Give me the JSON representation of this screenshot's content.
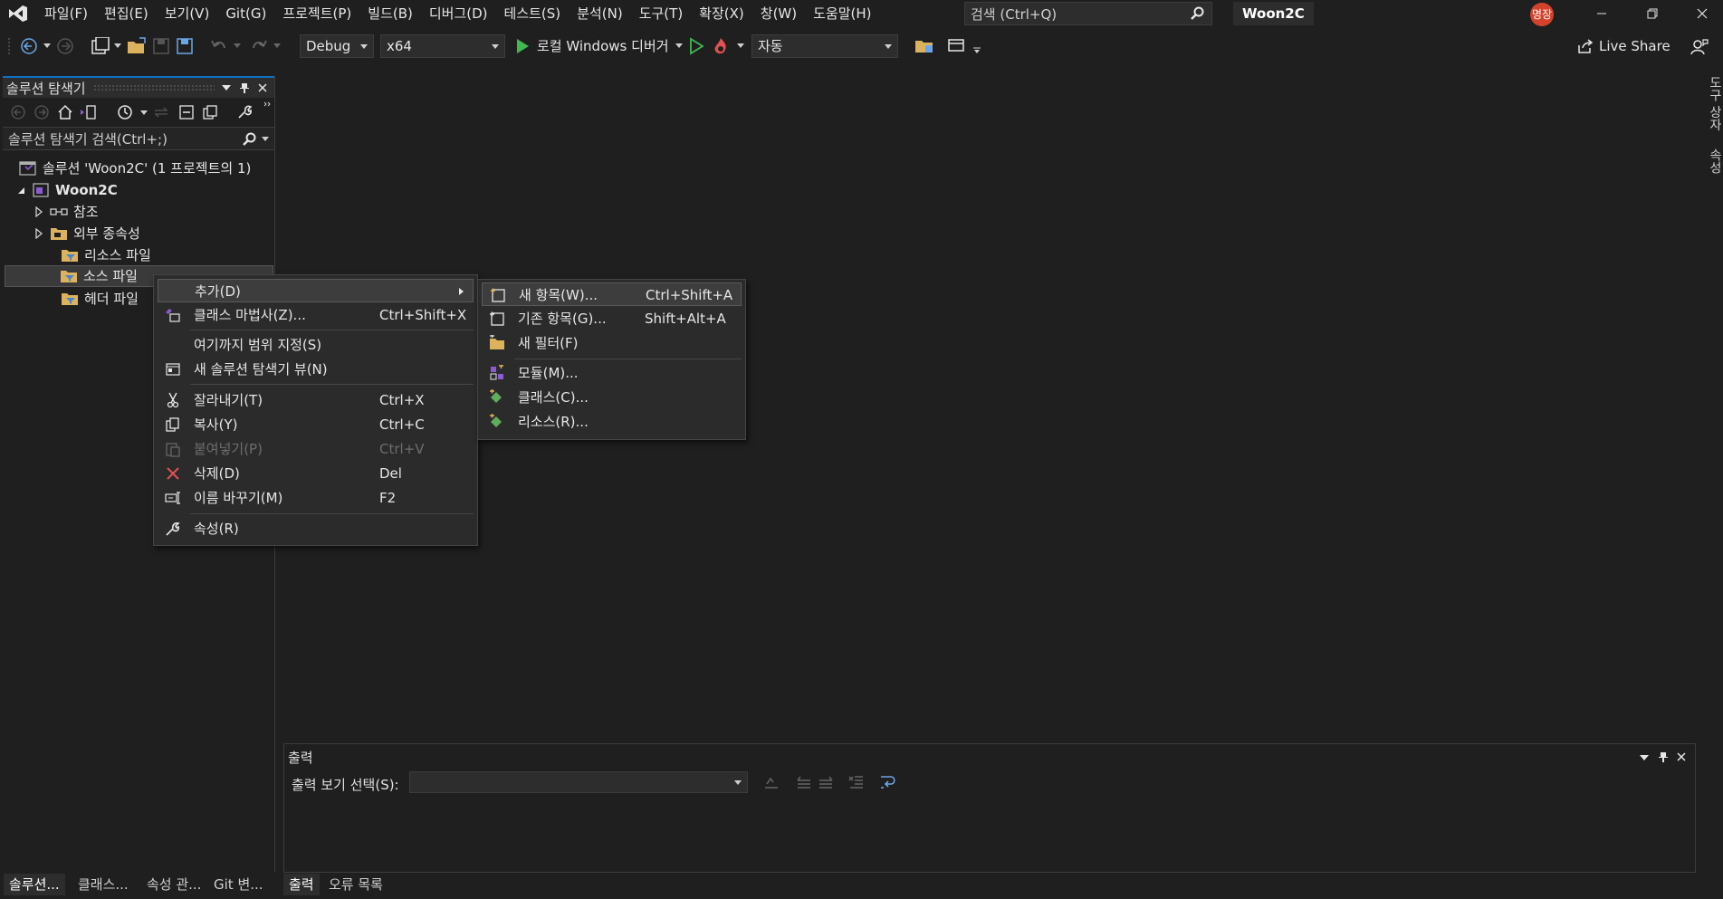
{
  "menu": [
    "파일(F)",
    "편집(E)",
    "보기(V)",
    "Git(G)",
    "프로젝트(P)",
    "빌드(B)",
    "디버그(D)",
    "테스트(S)",
    "분석(N)",
    "도구(T)",
    "확장(X)",
    "창(W)",
    "도움말(H)"
  ],
  "search": {
    "placeholder": "검색 (Ctrl+Q)"
  },
  "solution_name": "Woon2C",
  "user_initials": "명장",
  "toolbar": {
    "config": "Debug",
    "platform": "x64",
    "run_target": "로컬 Windows 디버거",
    "auto": "자동",
    "live_share": "Live Share"
  },
  "solution_explorer": {
    "title": "솔루션 탐색기",
    "search_placeholder": "솔루션 탐색기 검색(Ctrl+;)",
    "tree": [
      "솔루션 'Woon2C' (1 프로젝트의 1)",
      "Woon2C",
      "참조",
      "외부 종속성",
      "리소스 파일",
      "소스 파일",
      "헤더 파일"
    ]
  },
  "context_menu": {
    "items": [
      {
        "label": "추가(D)",
        "shortcut": ""
      },
      {
        "label": "클래스 마법사(Z)...",
        "shortcut": "Ctrl+Shift+X"
      },
      {
        "label": "여기까지 범위 지정(S)",
        "shortcut": ""
      },
      {
        "label": "새 솔루션 탐색기 뷰(N)",
        "shortcut": ""
      },
      {
        "label": "잘라내기(T)",
        "shortcut": "Ctrl+X"
      },
      {
        "label": "복사(Y)",
        "shortcut": "Ctrl+C"
      },
      {
        "label": "붙여넣기(P)",
        "shortcut": "Ctrl+V"
      },
      {
        "label": "삭제(D)",
        "shortcut": "Del"
      },
      {
        "label": "이름 바꾸기(M)",
        "shortcut": "F2"
      },
      {
        "label": "속성(R)",
        "shortcut": ""
      }
    ]
  },
  "submenu": {
    "items": [
      {
        "label": "새 항목(W)...",
        "shortcut": "Ctrl+Shift+A"
      },
      {
        "label": "기존 항목(G)...",
        "shortcut": "Shift+Alt+A"
      },
      {
        "label": "새 필터(F)",
        "shortcut": ""
      },
      {
        "label": "모듈(M)...",
        "shortcut": ""
      },
      {
        "label": "클래스(C)...",
        "shortcut": ""
      },
      {
        "label": "리소스(R)...",
        "shortcut": ""
      }
    ]
  },
  "output": {
    "title": "출력",
    "source_label": "출력 보기 선택(S):"
  },
  "bottom_tabs_left": [
    "솔루션...",
    "클래스...",
    "속성 관...",
    "Git 변..."
  ],
  "bottom_tabs_right": [
    "출력",
    "오류 목록"
  ],
  "right_rail": [
    "도구 상자",
    "속성"
  ],
  "colors": {
    "accent": "#0e70c0",
    "run_green": "#3fb950",
    "delete_red": "#e05252",
    "purple": "#8c5bd4"
  }
}
